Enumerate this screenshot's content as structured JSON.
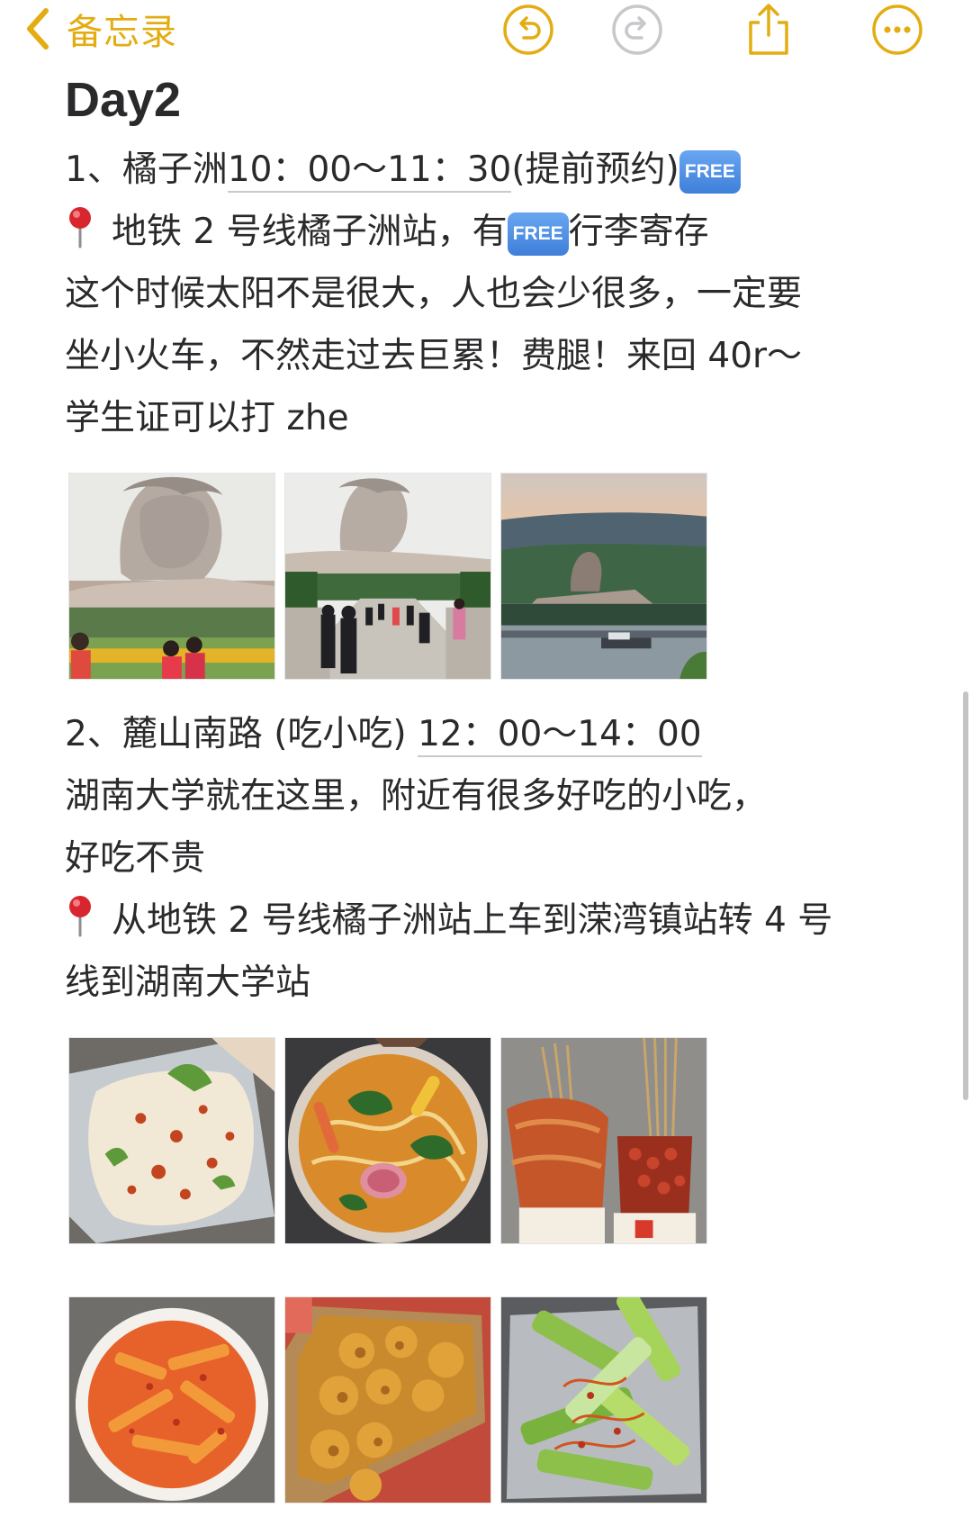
{
  "app": {
    "back_label": "备忘录",
    "accent_color": "#e3ad11",
    "icons": [
      "chevron-left-icon",
      "undo-icon",
      "redo-icon",
      "share-icon",
      "more-icon"
    ]
  },
  "note": {
    "title": "Day2",
    "section1": {
      "heading_prefix": "1、橘子洲",
      "time": "10：00～11：30",
      "heading_suffix": "(提前预约)",
      "free_badge": "FREE",
      "metro_before": "地铁 2 号线橘子洲站，有",
      "metro_after": "行李寄存",
      "desc_line1": "这个时候太阳不是很大，人也会少很多，一定要",
      "desc_line2": "坐小火车，不然走过去巨累！费腿！来回 40r～",
      "desc_line3": "学生证可以打 zhe"
    },
    "section2": {
      "heading_prefix": "2、麓山南路 (吃小吃)",
      "time": "12：00～14：00",
      "desc_line1": "湖南大学就在这里，附近有很多好吃的小吃，",
      "desc_line2": "好吃不贵",
      "metro_line1": "从地铁 2 号线橘子洲站上车到溁湾镇站转 4 号",
      "metro_line2": "线到湖南大学站"
    }
  }
}
